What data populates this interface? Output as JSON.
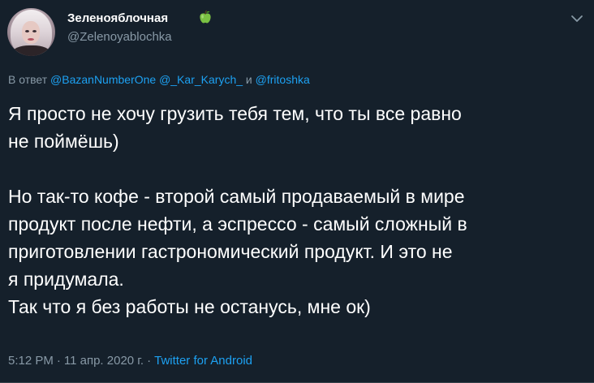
{
  "author": {
    "display_name": "Зеленояблочная",
    "handle": "@Zelenoyablochka",
    "badge_icon": "green-apple-icon",
    "menu_icon": "chevron-down-icon"
  },
  "reply": {
    "prefix": "В ответ",
    "mentions": [
      "@BazanNumberOne",
      "@_Kar_Karych_",
      "@fritoshka"
    ],
    "conjunction": "и"
  },
  "tweet": {
    "paragraph_1": "Я просто не хочу грузить тебя тем, что ты все равно\nне поймёшь)",
    "paragraph_2": "Но так-то кофе - второй самый продаваемый в мире\nпродукт после нефти, а эспрессо - самый сложный в\nприготовлении гастрономический продукт. И это не\nя придумала.\nТак что я без работы не останусь, мне ок)"
  },
  "meta": {
    "time": "5:12 PM",
    "date": "11 апр. 2020 г.",
    "separator": "·",
    "source": "Twitter for Android"
  },
  "colors": {
    "background": "#15202b",
    "text_primary": "#ffffff",
    "text_secondary": "#8899a6",
    "link": "#1da1f2",
    "apple": "#7ac143"
  }
}
